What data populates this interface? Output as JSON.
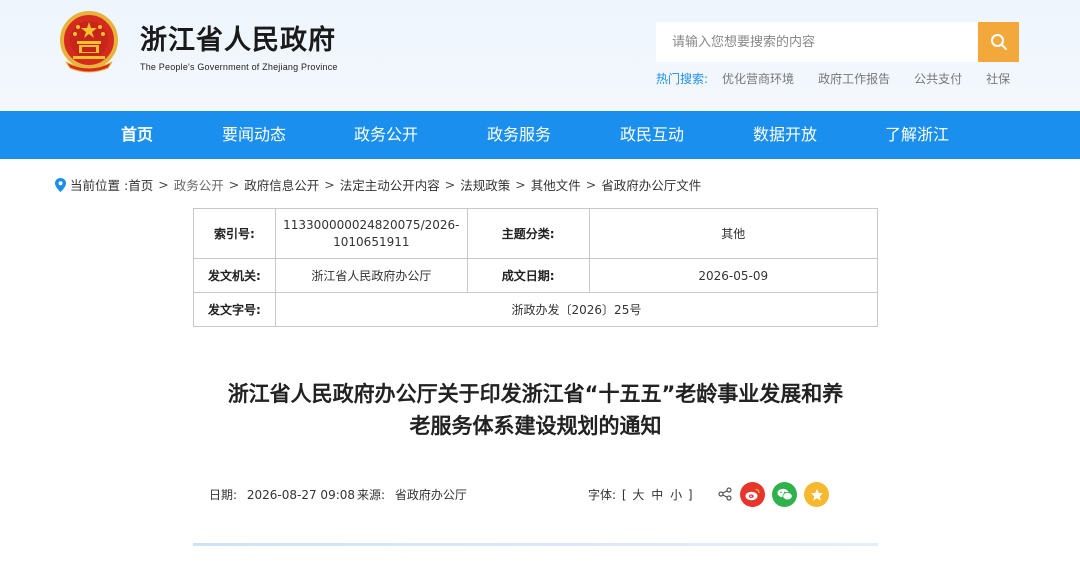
{
  "header": {
    "title": "浙江省人民政府",
    "subtitle": "The People's Government of Zhejiang Province",
    "search_placeholder": "请输入您想要搜索的内容",
    "hot_label": "热门搜索:",
    "hot_items": [
      "优化营商环境",
      "政府工作报告",
      "公共支付",
      "社保"
    ]
  },
  "nav": [
    "首页",
    "要闻动态",
    "政务公开",
    "政务服务",
    "政民互动",
    "数据开放",
    "了解浙江"
  ],
  "breadcrumb": {
    "prefix": "当前位置 :",
    "items": [
      "首页",
      "政务公开",
      "政府信息公开",
      "法定主动公开内容",
      "法规政策",
      "其他文件",
      "省政府办公厅文件"
    ]
  },
  "info": {
    "index_label": "索引号:",
    "index_value_line1": "113300000024820075/2026-",
    "index_value_line2": "1010651911",
    "topic_label": "主题分类:",
    "topic_value": "其他",
    "issuer_label": "发文机关:",
    "issuer_value": "浙江省人民政府办公厅",
    "date_label": "成文日期:",
    "date_value": "2026-05-09",
    "docno_label": "发文字号:",
    "docno_value": "浙政办发〔2026〕25号"
  },
  "document": {
    "title_line1": "浙江省人民政府办公厅关于印发浙江省“十五五”老龄事业发展和养",
    "title_line2": "老服务体系建设规划的通知"
  },
  "meta": {
    "date_label": "日期:",
    "date_value": "2026-08-27 09:08",
    "source_label": "来源:",
    "source_value": "省政府办公厅",
    "font_label": "字体:",
    "font_open": "[",
    "font_large": "大",
    "font_medium": "中",
    "font_small": "小",
    "font_close": "]"
  },
  "colors": {
    "nav_bg": "#1a8fee",
    "search_btn": "#f3a83c",
    "weibo": "#e6352b",
    "wechat": "#2fb24c",
    "favorite": "#f5b82e"
  },
  "icons": [
    "national-emblem-icon",
    "search-icon",
    "location-pin-icon",
    "share-icon",
    "weibo-icon",
    "wechat-icon",
    "favorite-icon"
  ]
}
